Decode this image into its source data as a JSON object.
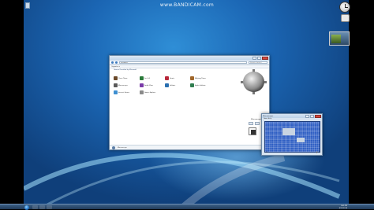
{
  "watermark": "www.BANDICAM.com",
  "explorer": {
    "address": "▸ Games",
    "search_placeholder": "Search Games",
    "toolbar": "Organize ▾",
    "section_header": "Games Provided by Microsoft",
    "items": [
      {
        "label": "Chess Titans",
        "icon_color": "#6b4a2a"
      },
      {
        "label": "FreeCell",
        "icon_color": "#2a7a3a"
      },
      {
        "label": "Hearts",
        "icon_color": "#b8273a"
      },
      {
        "label": "Mahjong Titans",
        "icon_color": "#a0662a"
      },
      {
        "label": "Minesweeper",
        "icon_color": "#5a5a5a"
      },
      {
        "label": "Purble Place",
        "icon_color": "#7a3aa8"
      },
      {
        "label": "Solitaire",
        "icon_color": "#2a6fb0"
      },
      {
        "label": "Spider Solitaire",
        "icon_color": "#2f7d4f"
      },
      {
        "label": "Internet Games",
        "icon_color": "#3e8fd1"
      },
      {
        "label": "Games Explorer",
        "icon_color": "#8a8a8a"
      }
    ],
    "side_panel_label": "Minesweeper",
    "status_text": "Minesweeper"
  },
  "minesweeper": {
    "title": "Minesweeper",
    "menu": "Game  Help",
    "footer_left": "⏱ 21",
    "footer_right": "💣 76"
  },
  "taskbar": {
    "time": "3:45 PM",
    "date": "8/12/2014"
  }
}
